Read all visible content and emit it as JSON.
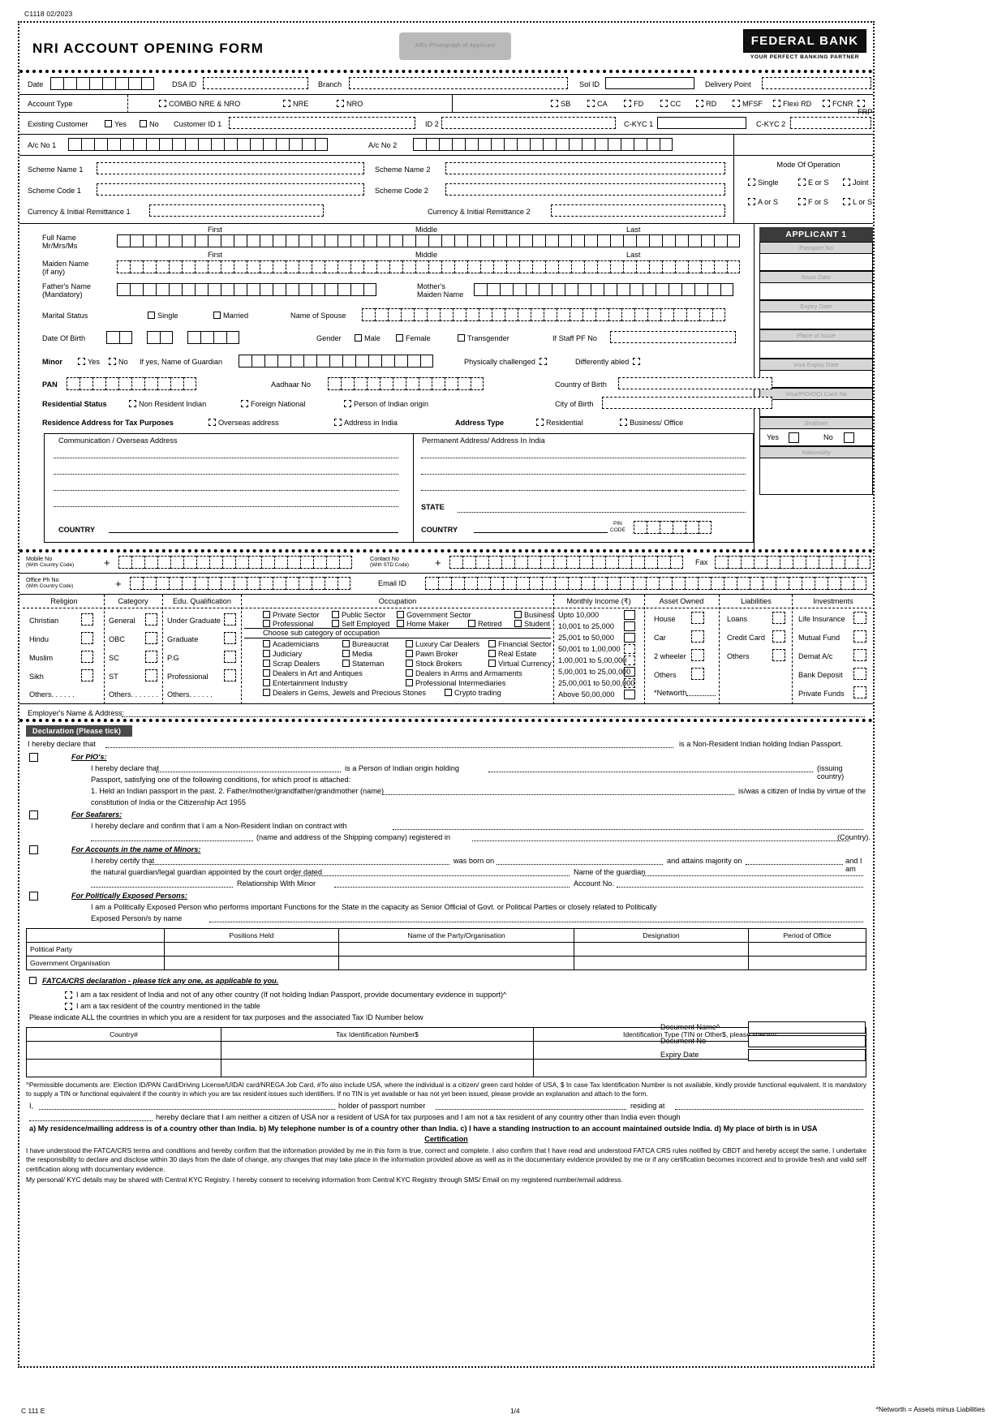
{
  "meta": {
    "form_code": "C1118 02/2023",
    "footer_left": "C 111 E",
    "footer_center": "1/4",
    "footer_right": "*Networth = Assets minus Liabilities"
  },
  "header": {
    "title": "NRI ACCOUNT OPENING FORM",
    "photo_box": "Affix Photograph of Applicant",
    "logo_main": "FEDERAL BANK",
    "logo_tagline": "YOUR PERFECT BANKING PARTNER"
  },
  "top": {
    "date_label": "Date",
    "dsa_label": "DSA ID",
    "branch_label": "Branch",
    "sol_label": "Sol ID",
    "delivery_label": "Delivery Point",
    "account_type_label": "Account Type",
    "account_types": [
      "COMBO NRE & NRO",
      "NRE",
      "NRO"
    ],
    "product_types": [
      "SB",
      "CA",
      "FD",
      "CC",
      "RD",
      "MFSF",
      "Flexi RD",
      "FCNR",
      "FRP"
    ],
    "existing_customer_label": "Existing Customer",
    "yes": "Yes",
    "no": "No",
    "customer_id_label": "Customer ID 1",
    "id2_label": "ID 2",
    "ckyc1_label": "C-KYC 1",
    "ckyc2_label": "C-KYC 2",
    "ac_no_1_label": "A/c No 1",
    "ac_no_2_label": "A/c No 2",
    "scheme_name_1": "Scheme Name 1",
    "scheme_name_2": "Scheme Name 2",
    "scheme_code_1": "Scheme Code 1",
    "scheme_code_2": "Scheme Code 2",
    "currency_1": "Currency & Initial Remittance 1",
    "currency_2": "Currency & Initial Remittance 2",
    "mode_title": "Mode Of Operation",
    "mode_options": [
      "Single",
      "E or S",
      "Joint",
      "A or S",
      "F or S",
      "L or S"
    ]
  },
  "applicant": {
    "full_name_label": "Full Name",
    "full_name_sub": "Mr/Mrs/Ms",
    "col_first": "First",
    "col_middle": "Middle",
    "col_last": "Last",
    "maiden_name_label": "Maiden Name",
    "maiden_name_sub": "(if any)",
    "fathers_name_label": "Father's Name",
    "fathers_name_sub": "(Mandatory)",
    "mothers_maiden_label": "Mother's",
    "mothers_maiden_sub": "Maiden Name",
    "marital_status_label": "Marital Status",
    "marital_options": [
      "Single",
      "Married"
    ],
    "spouse_label": "Name of Spouse",
    "dob_label": "Date Of Birth",
    "gender_label": "Gender",
    "gender_options": [
      "Male",
      "Female",
      "Transgender"
    ],
    "staff_pf_label": "If Staff PF No",
    "minor_label": "Minor",
    "guardian_label": "If yes, Name of Guardian",
    "phys_challenged": "Physically challenged",
    "diff_abled": "Differently abled",
    "pan_label": "PAN",
    "aadhaar_label": "Aadhaar No",
    "country_birth_label": "Country of Birth",
    "city_birth_label": "City of Birth",
    "residential_status_label": "Residential Status",
    "residential_options": [
      "Non Resident Indian",
      "Foreign National",
      "Person of Indian origin"
    ],
    "res_addr_tax_label": "Residence Address for Tax Purposes",
    "res_addr_options": [
      "Overseas address",
      "Address in India"
    ],
    "address_type_label": "Address Type",
    "address_type_options": [
      "Residential",
      "Business/ Office"
    ],
    "comm_addr_title": "Communication / Overseas Address",
    "perm_addr_title": "Permanent Address/ Address In India",
    "country_label": "COUNTRY",
    "state_label": "STATE",
    "pin_label": "PIN",
    "code_label": "CODE",
    "mobile_label": "Mobile No",
    "mobile_sub": "(With Country Code)",
    "contact_label": "Contact No",
    "contact_sub": "(With STD Code)",
    "fax_label": "Fax",
    "office_ph_label": "Office Ph No",
    "office_ph_sub": "(With Country Code)",
    "email_label": "Email ID"
  },
  "sidebar": {
    "banner": "APPLICANT 1",
    "items": [
      "Passport No",
      "Issue Date",
      "Expiry Date",
      "Place of Issue",
      "Visa Expiry Date",
      "Visa/PIO/OCI Card No"
    ],
    "seafarer_label": "Seafarer",
    "seafarer_yes": "Yes",
    "seafarer_no": "No",
    "nationality_label": "Nationality"
  },
  "profile": {
    "religion_title": "Religion",
    "religion_items": [
      "Christian",
      "Hindu",
      "Muslim",
      "Sikh"
    ],
    "religion_other": "Others. . . . . .",
    "category_title": "Category",
    "category_items": [
      "General",
      "OBC",
      "SC",
      "ST"
    ],
    "category_other": "Others. . . . . . .",
    "edu_title": "Edu. Qualification",
    "edu_items": [
      "Under Graduate",
      "Graduate",
      "P.G",
      "Professional"
    ],
    "edu_other": "Others. . . . . .",
    "occupation_title": "Occupation",
    "occupation_row1": [
      "Private Sector",
      "Public Sector",
      "Government Sector",
      "Business"
    ],
    "occupation_row2": [
      "Professional",
      "Self Employed",
      "Home Maker",
      "Retired",
      "Student"
    ],
    "subcat_title": "Choose sub category of occupation",
    "subcat_col1": [
      "Academicians",
      "Judiciary",
      "Scrap Dealers",
      "Dealers in Art and Antiques",
      "Entertainment Industry",
      "Dealers in Gems, Jewels and Precious Stones"
    ],
    "subcat_col2": [
      "Bureaucrat",
      "Media",
      "Stateman"
    ],
    "subcat_col3": [
      "Luxury Car Dealers",
      "Pawn Broker",
      "Stock Brokers",
      "Dealers in Arms and Armaments",
      "Professional Intermediaries",
      "Crypto trading"
    ],
    "subcat_col4": [
      "Financial Sector",
      "Real Estate",
      "Virtual Currency"
    ],
    "income_title": "Monthly Income (₹)",
    "income_items": [
      "Upto 10,000",
      "10,001 to 25,000",
      "25,001 to 50,000",
      "50,001 to 1,00,000",
      "1,00,001 to 5,00,000",
      "5,00,001 to 25,00,000",
      "25,00,001 to 50,00,000",
      "Above 50,00,000"
    ],
    "asset_title": "Asset Owned",
    "asset_items": [
      "House",
      "Car",
      "2 wheeler",
      "Others"
    ],
    "networth_label": "*Networth",
    "liab_title": "Liabilities",
    "liab_items": [
      "Loans",
      "Credit Card",
      "Others"
    ],
    "inv_title": "Investments",
    "inv_items": [
      "Life Insurance",
      "Mutual Fund",
      "Demat A/c",
      "Bank Deposit",
      "Private Funds"
    ],
    "employer_label": "Employer's Name & Address:"
  },
  "declaration": {
    "title": "Declaration (Please tick)",
    "intro_pre": "I hereby declare that",
    "intro_post": "is a Non-Resident Indian holding Indian Passport.",
    "pio_head": "For PIO's:",
    "pio_l1_pre": "I hereby declare that",
    "pio_l1_mid": "is a Person of Indian origin holding",
    "pio_l1_post": "(issuing country)",
    "pio_l2": "Passport, satisfying one of the following conditions, for which proof is attached:",
    "pio_l3_pre": "1. Held an Indian passport in the past.   2. Father/mother/grandfather/grandmother (name)",
    "pio_l3_post": "is/was a citizen of India by virtue of the",
    "pio_l4": "constitution of India or the Citizenship Act 1955",
    "sea_head": "For Seafarers:",
    "sea_l1": "I hereby declare and confirm that I am a Non-Resident Indian on contract with",
    "sea_l2_mid": "(name and address of the Shipping company) registered in",
    "sea_l2_post": "(Country).",
    "minor_head": "For Accounts in the name of Minors:",
    "minor_l1_pre": "I hereby certify that",
    "minor_l1_m1": "was born on",
    "minor_l1_m2": "and attains majority on",
    "minor_l1_post": "and I am",
    "minor_l2_pre": "the natural guardian/legal guardian appointed by the court order dated",
    "minor_l2_post": "Name of the guardian",
    "minor_l3_pre": "Relationship With Minor",
    "minor_l3_post": "Account No.",
    "pep_head": "For Politically Exposed Persons:",
    "pep_l1": "I am a Politically Exposed Person who performs important Functions for the State in the capacity as Senior Official of Govt. or Political Parties or closely related to Politically",
    "pep_l2": "Exposed Person/s by name",
    "pep_table_headers": [
      "",
      "Positions Held",
      "Name of the Party/Organisation",
      "Designation",
      "Period of Office"
    ],
    "pep_rows": [
      "Political Party",
      "Government Organisation"
    ]
  },
  "fatca": {
    "heading": "FATCA/CRS declaration - please tick any one, as applicable to you.",
    "opt1": "I am a tax resident of India and not of any other country (If not holding Indian Passport, provide documentary evidence in support)^",
    "opt2": "I am a tax resident of the country mentioned in the table",
    "note": "Please indicate ALL the countries in which you are a resident for tax purposes and the associated Tax ID Number below",
    "doc_name_label": "Document Name^",
    "doc_no_label": "Document No",
    "expiry_label": "Expiry Date",
    "table_headers": [
      "Country#",
      "Tax Identification Number$",
      "Identification Type (TIN or Other$, please specify)"
    ],
    "footnote": "^Permissible documents are: Election ID/PAN Card/Driving License/UIDAI card/NREGA Job Card, #To also include USA, where the individual is a citizen/ green card holder of USA, $ In case Tax Identification Number is not available, kindly provide functional equivalent. It is mandatory to supply a TIN or functional equivalent if the country in which you are tax resident issues such identifiers. If no TIN is yet available or has not yet been issued, please provide an explanation and attach to the form.",
    "cert_l1_pre": "I,",
    "cert_l1_m1": "holder of passport number",
    "cert_l1_m2": "residing at",
    "cert_l2": "hereby declare that I am neither a citizen of USA nor a resident of USA for tax purposes and I am not a tax resident of any country other than India even though",
    "cert_l3": "a) My residence/mailing address is of a country other than India. b) My telephone number is of a country other than India. c) I have a standing instruction to an account maintained outside India. d) My place of birth is in USA",
    "cert_title": "Certification",
    "cert_p1": "I have understood the FATCA/CRS terms and conditions and hereby confirm that the information provided by me in this form is true, correct and complete. I also confirm that I have read and understood FATCA CRS rules notified by CBDT and hereby accept the same. I undertake the responsibility to declare and disclose within 30 days from the date of change, any changes that may take place in the information provided above as well as in the documentary evidence provided by me or if any certification becomes incorrect and to provide fresh and valid self certification along with documentary evidence.",
    "cert_p2": "My personal/ KYC details may be shared with Central KYC Registry. I hereby consent to receiving information from Central KYC Registry through SMS/ Email on my registered number/email address."
  }
}
